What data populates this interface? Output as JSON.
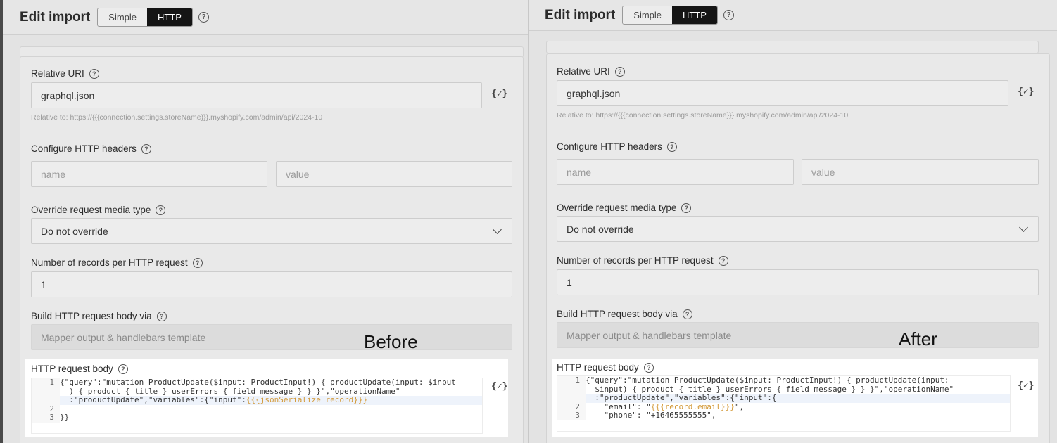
{
  "header": {
    "title": "Edit import",
    "modes": [
      "Simple",
      "HTTP"
    ],
    "active_mode": "HTTP"
  },
  "form": {
    "relative_uri": {
      "label": "Relative URI",
      "value": "graphql.json",
      "hint": "Relative to: https://{{{connection.settings.storeName}}}.myshopify.com/admin/api/2024-10"
    },
    "headers": {
      "label": "Configure HTTP headers",
      "name_placeholder": "name",
      "value_placeholder": "value"
    },
    "media_type": {
      "label": "Override request media type",
      "value": "Do not override"
    },
    "records_per_request": {
      "label": "Number of records per HTTP request",
      "value": "1"
    },
    "build_body": {
      "label": "Build HTTP request body via",
      "value": "Mapper output & handlebars template"
    },
    "body_label": "HTTP request body",
    "handlebars_icon": "{✓}"
  },
  "before": {
    "caption": "Before",
    "lines": [
      {
        "n": "1",
        "parts": [
          {
            "t": "{\"query\":\"mutation ProductUpdate($input: ProductInput!) { productUpdate(input: $input"
          }
        ]
      },
      {
        "n": "",
        "parts": [
          {
            "t": "  ) { product { title } userErrors { field message } } }\",\"operationName\""
          }
        ]
      },
      {
        "n": "",
        "parts": [
          {
            "t": "  :\"productUpdate\",\"variables\":{\"input\":"
          },
          {
            "t": "{{{jsonSerialize record}}}",
            "hl": true
          }
        ]
      },
      {
        "n": "2",
        "parts": [
          {
            "t": ""
          }
        ]
      },
      {
        "n": "3",
        "parts": [
          {
            "t": "}}"
          }
        ]
      }
    ]
  },
  "after": {
    "caption": "After",
    "lines": [
      {
        "n": "1",
        "parts": [
          {
            "t": "{\"query\":\"mutation ProductUpdate($input: ProductInput!) { productUpdate(input:"
          }
        ]
      },
      {
        "n": "",
        "parts": [
          {
            "t": "  $input) { product { title } userErrors { field message } } }\",\"operationName\""
          }
        ]
      },
      {
        "n": "",
        "parts": [
          {
            "t": "  :\"productUpdate\",\"variables\":{\"input\":{"
          }
        ]
      },
      {
        "n": "2",
        "parts": [
          {
            "t": "    \"email\": \""
          },
          {
            "t": "{{{record.email}}}",
            "hl": true
          },
          {
            "t": "\","
          }
        ]
      },
      {
        "n": "3",
        "parts": [
          {
            "t": "    \"phone\": \"+16465555555\","
          }
        ]
      }
    ]
  }
}
